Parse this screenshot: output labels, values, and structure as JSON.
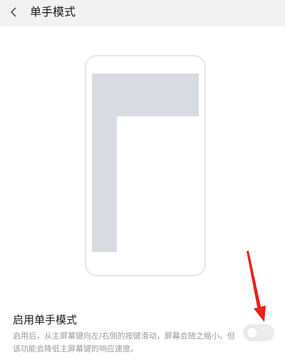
{
  "header": {
    "title": "单手模式",
    "back_icon": "chevron-left-icon"
  },
  "setting": {
    "title": "启用单手模式",
    "description": "启用后，从主屏幕键向左/右侧的按键滑动，屏幕会随之缩小。但该功能会降低主屏幕键的响应速度。",
    "enabled": false
  },
  "colors": {
    "header_bg": "#f2f2f2",
    "phone_outline": "#e6e6e6",
    "screen_gray": "#d9dbe2",
    "annotation_arrow": "#e8221b"
  }
}
